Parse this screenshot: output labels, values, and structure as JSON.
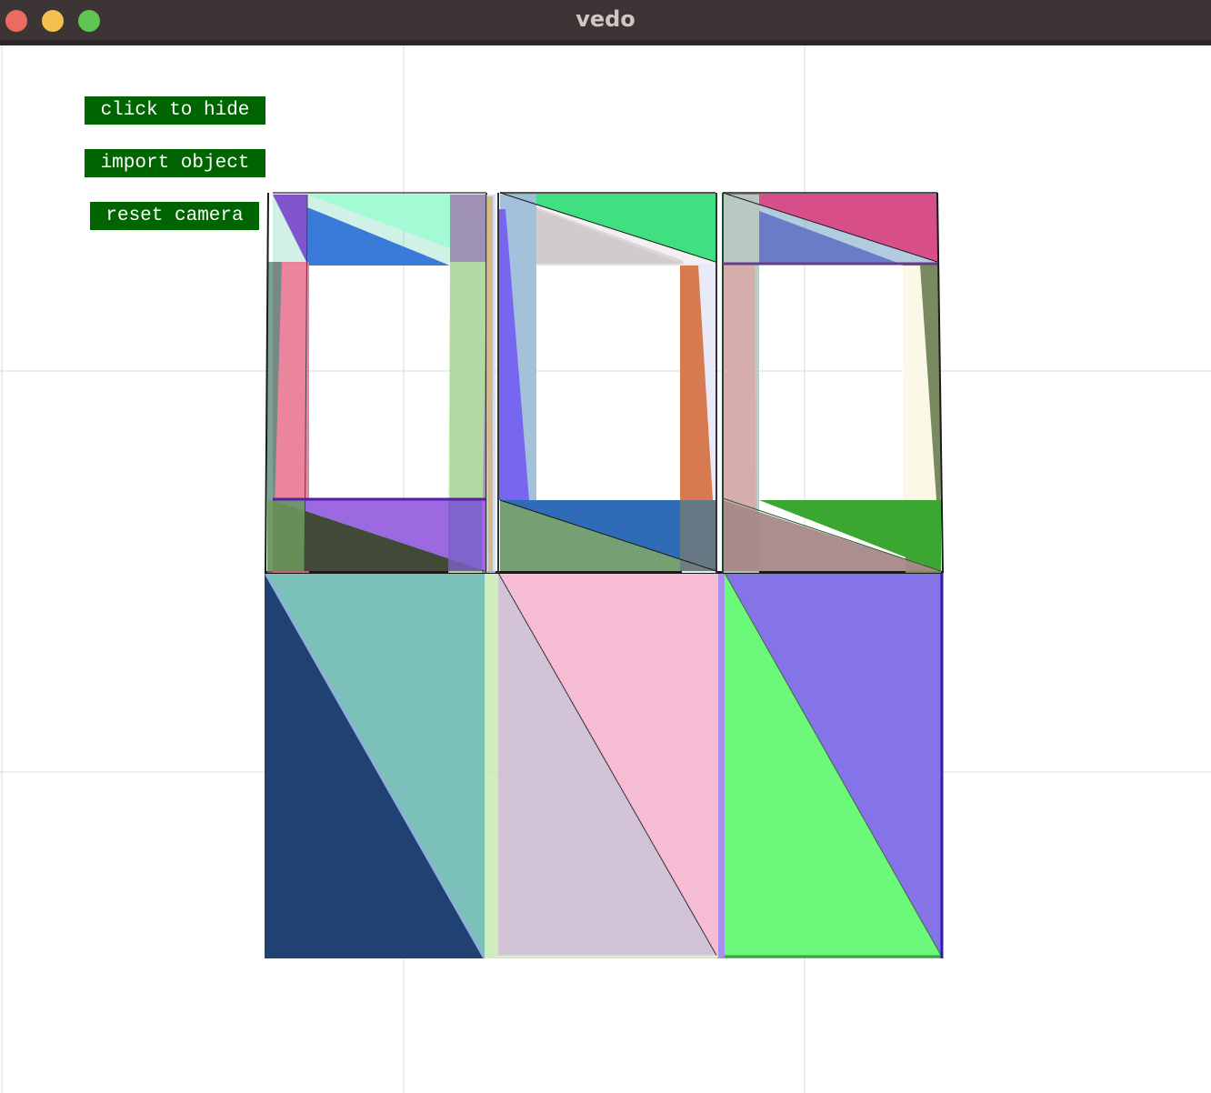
{
  "window": {
    "title": "vedo",
    "controls": [
      "close",
      "minimize",
      "maximize"
    ]
  },
  "buttons": {
    "hide_label": "click to hide",
    "import_label": "import object",
    "reset_label": "reset camera"
  },
  "colors": {
    "button_bg": "#006400",
    "button_text": "#ffffff",
    "titlebar": "#3d3535"
  },
  "scene": {
    "description_icons": [
      "gear-box-mesh"
    ],
    "grid": true
  }
}
